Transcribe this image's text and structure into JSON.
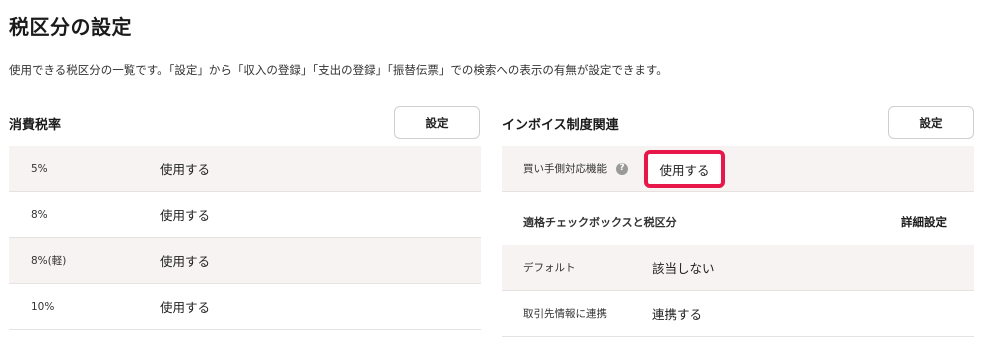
{
  "page": {
    "title": "税区分の設定",
    "description": "使用できる税区分の一覧です。「設定」から「収入の登録」「支出の登録」「振替伝票」での検索への表示の有無が設定できます。"
  },
  "consumption_tax": {
    "heading": "消費税率",
    "settings_button": "設定",
    "rows": [
      {
        "rate": "5%",
        "status": "使用する"
      },
      {
        "rate": "8%",
        "status": "使用する"
      },
      {
        "rate": "8%(軽)",
        "status": "使用する"
      },
      {
        "rate": "10%",
        "status": "使用する"
      }
    ]
  },
  "invoice": {
    "heading": "インボイス制度関連",
    "settings_button": "設定",
    "buyer_feature": {
      "label": "買い手側対応機能",
      "help_icon": "question-circle-icon",
      "value": "使用する",
      "highlight_color": "#e8174a"
    },
    "qualified_check": {
      "heading": "適格チェックボックスと税区分",
      "detail_link": "詳細設定"
    },
    "default": {
      "label": "デフォルト",
      "value": "該当しない"
    },
    "partner_link": {
      "label": "取引先情報に連携",
      "value": "連携する"
    }
  }
}
